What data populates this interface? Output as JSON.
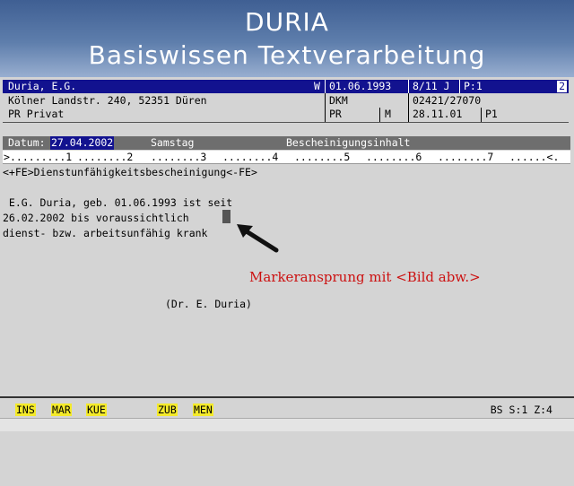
{
  "header": {
    "title": "DURIA",
    "subtitle": "Basiswissen Textverarbeitung"
  },
  "patient": {
    "name": "Duria, E.G.",
    "flag": "W",
    "birthdate": "01.06.1993",
    "age": "8/11 J",
    "page": "P:1",
    "number": "2",
    "address": "Kölner Landstr. 240, 52351 Düren",
    "insurance": "DKM",
    "phone": "02421/27070",
    "type": "PR Privat",
    "type_code": "PR",
    "gender": "M",
    "last_date": "28.11.01",
    "last_page": "P1"
  },
  "datum_bar": {
    "label": "Datum:",
    "date": "27.04.2002",
    "weekday": "Samstag",
    "section": "Bescheinigungsinhalt"
  },
  "ruler": {
    "start": ">",
    "marks": [
      ".........1",
      "........2",
      "........3",
      "........4",
      "........5",
      "........6",
      "........7",
      "......<."
    ]
  },
  "document": {
    "lines": [
      "<+FE>Dienstunfähigkeitsbescheinigung<-FE>",
      "",
      " E.G. Duria, geb. 01.06.1993 ist seit",
      "26.02.2002 bis voraussichtlich",
      "dienst- bzw. arbeitsunfähig krank"
    ],
    "signature": "(Dr. E. Duria)"
  },
  "annotation": "Markeransprung mit <Bild abw.>",
  "footer": {
    "keys": [
      "INS",
      "MAR",
      "KUE",
      "ZUB",
      "MEN"
    ],
    "status": "BS S:1 Z:4"
  },
  "colors": {
    "header_gradient_top": "#3f5f93",
    "patient_bar": "#12128f",
    "key_highlight": "#f4ea2a",
    "annotation": "#cc1111"
  }
}
